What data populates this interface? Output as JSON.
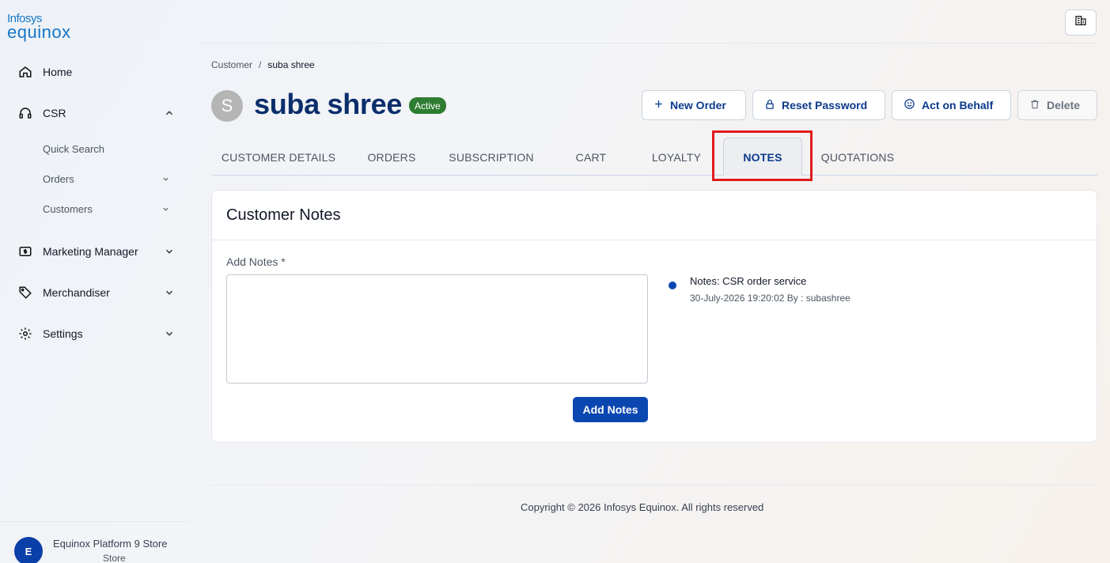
{
  "brand": {
    "line1": "Infosys",
    "line2": "equinox"
  },
  "sidebar": {
    "items": [
      {
        "label": "Home",
        "icon": "home-icon"
      },
      {
        "label": "CSR",
        "icon": "headset-icon",
        "expanded": true,
        "children": [
          {
            "label": "Quick Search"
          },
          {
            "label": "Orders"
          },
          {
            "label": "Customers"
          }
        ]
      },
      {
        "label": "Marketing Manager",
        "icon": "dollar-icon"
      },
      {
        "label": "Merchandiser",
        "icon": "tag-icon"
      },
      {
        "label": "Settings",
        "icon": "gear-icon"
      }
    ],
    "store": {
      "initial": "E",
      "name": "Equinox Platform 9 Store",
      "sub": "Store"
    }
  },
  "breadcrumb": {
    "root": "Customer",
    "separator": "/",
    "current": "suba shree"
  },
  "customer": {
    "initial": "S",
    "name": "suba shree",
    "status": "Active"
  },
  "actions": {
    "new_order": "New Order",
    "reset_password": "Reset Password",
    "act_on_behalf": "Act on Behalf",
    "delete": "Delete"
  },
  "tabs": [
    {
      "label": "CUSTOMER DETAILS"
    },
    {
      "label": "ORDERS"
    },
    {
      "label": "SUBSCRIPTION"
    },
    {
      "label": "CART"
    },
    {
      "label": "LOYALTY"
    },
    {
      "label": "NOTES",
      "active": true
    },
    {
      "label": "QUOTATIONS"
    }
  ],
  "notes_card": {
    "title": "Customer Notes",
    "field_label": "Add Notes *",
    "field_value": "",
    "add_button": "Add Notes",
    "entries": [
      {
        "text": "Notes: CSR order service",
        "meta": "30-July-2026 19:20:02 By : subashree"
      }
    ]
  },
  "footer": {
    "copyright": "Copyright © 2026 Infosys Equinox. All rights reserved"
  },
  "colors": {
    "primary": "#0b47b0",
    "title": "#0b2e6b",
    "active_badge": "#2e7d32",
    "highlight": "#e01b1b"
  }
}
